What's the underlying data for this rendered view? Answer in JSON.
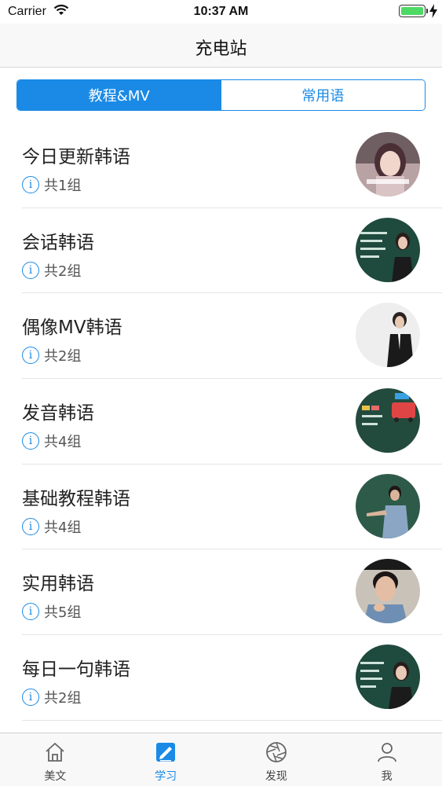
{
  "status_bar": {
    "carrier": "Carrier",
    "time": "10:37 AM",
    "battery_level": 1.0
  },
  "nav": {
    "title": "充电站"
  },
  "segments": [
    {
      "label": "教程&MV",
      "selected": true
    },
    {
      "label": "常用语",
      "selected": false
    }
  ],
  "list": [
    {
      "title": "今日更新韩语",
      "count": "共1组",
      "thumb": "woman-portrait"
    },
    {
      "title": "会话韩语",
      "count": "共2组",
      "thumb": "classroom-woman"
    },
    {
      "title": "偶像MV韩语",
      "count": "共2组",
      "thumb": "man-in-suit"
    },
    {
      "title": "发音韩语",
      "count": "共4组",
      "thumb": "chalkboard-bus"
    },
    {
      "title": "基础教程韩语",
      "count": "共4组",
      "thumb": "teacher-pointing"
    },
    {
      "title": "实用韩语",
      "count": "共5组",
      "thumb": "man-portrait"
    },
    {
      "title": "每日一句韩语",
      "count": "共2组",
      "thumb": "classroom-woman"
    }
  ],
  "tabs": [
    {
      "label": "美文",
      "icon": "home-icon",
      "active": false
    },
    {
      "label": "学习",
      "icon": "notebook-pen-icon",
      "active": true
    },
    {
      "label": "发现",
      "icon": "aperture-icon",
      "active": false
    },
    {
      "label": "我",
      "icon": "person-icon",
      "active": false
    }
  ],
  "colors": {
    "accent": "#1a8ae6",
    "divider": "#e5e5e5",
    "tab_bar_bg": "#f8f8f8"
  }
}
